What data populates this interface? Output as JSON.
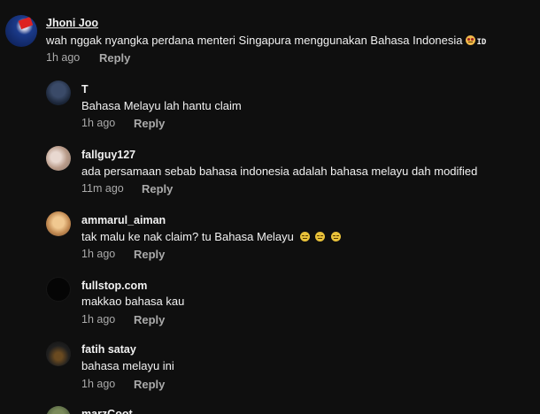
{
  "comments": [
    {
      "author": "Jhoni Joo",
      "text": "wah nggak nyangka perdana menteri Singapura menggunakan Bahasa Indonesia",
      "badge": "ID",
      "time": "1h ago",
      "reply": "Reply",
      "avatar_color": "#1b3a8a"
    }
  ],
  "replies": [
    {
      "author": "T",
      "text": "Bahasa Melayu lah hantu claim",
      "time": "1h ago",
      "reply": "Reply",
      "avatar_color": "#2a3a52"
    },
    {
      "author": "fallguy127",
      "text": "ada persamaan sebab bahasa indonesia adalah bahasa melayu dah modified",
      "time": "11m ago",
      "reply": "Reply",
      "avatar_color": "#c9b8a8"
    },
    {
      "author": "ammarul_aiman",
      "text": "tak malu ke nak claim? tu Bahasa Melayu",
      "time": "1h ago",
      "reply": "Reply",
      "avatar_color": "#d8a868"
    },
    {
      "author": "fullstop.com",
      "text": "makkao bahasa kau",
      "time": "1h ago",
      "reply": "Reply",
      "avatar_color": "#050505"
    },
    {
      "author": "fatih satay",
      "text": "bahasa melayu ini",
      "time": "1h ago",
      "reply": "Reply",
      "avatar_color": "#1a1a1a"
    },
    {
      "author": "marzCoot",
      "text": "",
      "time": "",
      "reply": "",
      "avatar_color": "#4a5a3a"
    }
  ],
  "colors": {
    "background": "#0f0f0f",
    "text": "#f1f1f1",
    "secondary": "#aaaaaa",
    "emoji": "#e8c13a"
  }
}
